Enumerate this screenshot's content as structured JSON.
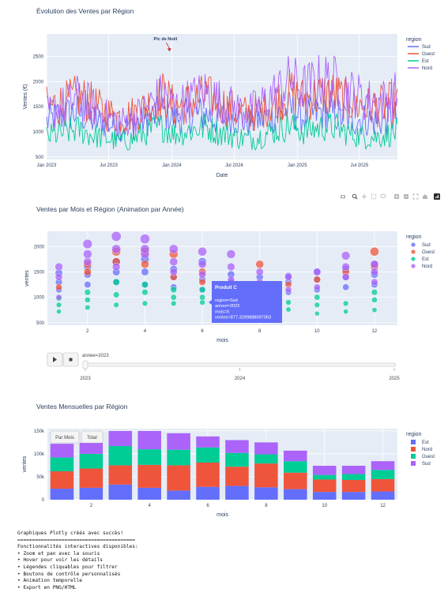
{
  "chart_data": [
    {
      "type": "line",
      "title": "Évolution des Ventes par Région",
      "xlabel": "Date",
      "ylabel": "Ventes (€)",
      "xlim": [
        "2023-01-01",
        "2025-10-20"
      ],
      "ylim": [
        450,
        2950
      ],
      "y_ticks": [
        500,
        1000,
        1500,
        2000,
        2500
      ],
      "x_ticks": [
        {
          "value": "2023-01-01",
          "label": "Jan 2023"
        },
        {
          "value": "2023-07-01",
          "label": "Jul 2023"
        },
        {
          "value": "2024-01-01",
          "label": "Jan 2024"
        },
        {
          "value": "2024-07-01",
          "label": "Jul 2024"
        },
        {
          "value": "2025-01-01",
          "label": "Jan 2025"
        },
        {
          "value": "2025-07-01",
          "label": "Jul 2025"
        }
      ],
      "legend_title": "region",
      "legend_position": "right",
      "grid": true,
      "annotation": {
        "text": "Pic de Noël",
        "x": "2023-12-25",
        "y": 2600
      },
      "series": [
        {
          "name": "Sud",
          "color": "#636efa",
          "approx_monthly_mean": [
            1200,
            1300,
            1350,
            1400,
            1250,
            1200,
            1150,
            1100,
            1150,
            1200,
            1300,
            1400,
            1250,
            1300,
            1350,
            1350,
            1250,
            1300,
            1250,
            1200,
            1250,
            1300,
            1350,
            1450,
            1300,
            1350,
            1400,
            1350,
            1300,
            1250,
            1250,
            1200,
            1250,
            1300
          ]
        },
        {
          "name": "Ouest",
          "color": "#ef553b",
          "approx_monthly_mean": [
            1500,
            1550,
            1600,
            1700,
            1600,
            1450,
            1350,
            1300,
            1350,
            1450,
            1600,
            1750,
            1500,
            1550,
            1650,
            1700,
            1600,
            1500,
            1400,
            1350,
            1400,
            1550,
            1650,
            1800,
            1650,
            1700,
            1750,
            1750,
            1650,
            1550,
            1500,
            1500,
            1550,
            1600
          ]
        },
        {
          "name": "Est",
          "color": "#00cc96",
          "approx_monthly_mean": [
            900,
            950,
            1000,
            1050,
            950,
            900,
            850,
            800,
            850,
            950,
            1050,
            1100,
            950,
            1000,
            1050,
            1100,
            1000,
            950,
            900,
            850,
            900,
            1000,
            1050,
            1150,
            1000,
            1050,
            1100,
            1100,
            1000,
            950,
            900,
            900,
            950,
            1000
          ]
        },
        {
          "name": "Nord",
          "color": "#ab63fa",
          "approx_monthly_mean": [
            1350,
            1450,
            1550,
            1700,
            1550,
            1400,
            1250,
            1200,
            1250,
            1400,
            1600,
            1750,
            1500,
            1600,
            1700,
            1800,
            1650,
            1550,
            1450,
            1400,
            1500,
            1700,
            1850,
            2050,
            1850,
            1950,
            2050,
            2000,
            1850,
            1750,
            1650,
            1600,
            1650,
            1750
          ]
        }
      ]
    },
    {
      "type": "scatter",
      "title": "Ventes par Mois et Région (Animation par Année)",
      "xlabel": "mois",
      "ylabel": "ventes",
      "xlim": [
        0.6,
        12.8
      ],
      "ylim": [
        450,
        2300
      ],
      "x_ticks": [
        2,
        4,
        6,
        8,
        10,
        12
      ],
      "y_ticks": [
        500,
        1000,
        1500,
        2000
      ],
      "legend_title": "region",
      "legend_position": "right",
      "grid": true,
      "series": [
        {
          "name": "Sud",
          "color": "#636efa",
          "points": [
            [
              1,
              1150
            ],
            [
              1,
              1300
            ],
            [
              1,
              1480
            ],
            [
              2,
              1250
            ],
            [
              2,
              1450
            ],
            [
              2,
              1600
            ],
            [
              3,
              1300
            ],
            [
              3,
              1500
            ],
            [
              3,
              1700
            ],
            [
              4,
              1250
            ],
            [
              4,
              1500
            ],
            [
              4,
              1750
            ],
            [
              5,
              1200
            ],
            [
              5,
              1400
            ],
            [
              5,
              1550
            ],
            [
              6,
              1150
            ],
            [
              6,
              1350
            ],
            [
              6,
              1700
            ],
            [
              7,
              1100
            ],
            [
              7,
              1300
            ],
            [
              7,
              1450
            ],
            [
              8,
              1050
            ],
            [
              8,
              1250
            ],
            [
              8,
              1400
            ],
            [
              9,
              1100
            ],
            [
              9,
              1300
            ],
            [
              9,
              1420
            ],
            [
              10,
              1150
            ],
            [
              10,
              1350
            ],
            [
              10,
              1500
            ],
            [
              11,
              1200
            ],
            [
              11,
              1400
            ],
            [
              11,
              1550
            ],
            [
              12,
              1250
            ],
            [
              12,
              1450
            ],
            [
              12,
              1650
            ]
          ]
        },
        {
          "name": "Ouest",
          "color": "#ef553b",
          "points": [
            [
              1,
              1200
            ],
            [
              2,
              1500
            ],
            [
              2,
              1650
            ],
            [
              3,
              1700
            ],
            [
              3,
              1900
            ],
            [
              4,
              1650
            ],
            [
              4,
              1900
            ],
            [
              5,
              1400
            ],
            [
              5,
              1850
            ],
            [
              6,
              1300
            ],
            [
              6,
              1500
            ],
            [
              7,
              1200
            ],
            [
              8,
              1650
            ],
            [
              9,
              1250
            ],
            [
              10,
              1350
            ],
            [
              11,
              1500
            ],
            [
              12,
              1600
            ],
            [
              12,
              1900
            ]
          ]
        },
        {
          "name": "Est",
          "color": "#00cc96",
          "points": [
            [
              1,
              720
            ],
            [
              1,
              850
            ],
            [
              1,
              980
            ],
            [
              2,
              800
            ],
            [
              2,
              950
            ],
            [
              2,
              1100
            ],
            [
              3,
              850
            ],
            [
              3,
              1050
            ],
            [
              3,
              1300
            ],
            [
              4,
              880
            ],
            [
              4,
              1100
            ],
            [
              4,
              1250
            ],
            [
              5,
              880
            ],
            [
              5,
              1000
            ],
            [
              5,
              1150
            ],
            [
              6,
              900
            ],
            [
              6,
              1000
            ],
            [
              6,
              1150
            ],
            [
              7,
              850
            ],
            [
              7,
              1050
            ],
            [
              8,
              800
            ],
            [
              8,
              950
            ],
            [
              9,
              760
            ],
            [
              9,
              900
            ],
            [
              10,
              680
            ],
            [
              10,
              850
            ],
            [
              10,
              1000
            ],
            [
              11,
              720
            ],
            [
              11,
              880
            ],
            [
              12,
              750
            ],
            [
              12,
              950
            ],
            [
              12,
              1100
            ]
          ]
        },
        {
          "name": "Nord",
          "color": "#ab63fa",
          "points": [
            [
              1,
              1000
            ],
            [
              1,
              1400
            ],
            [
              1,
              1600
            ],
            [
              2,
              1700
            ],
            [
              2,
              1850
            ],
            [
              2,
              2050
            ],
            [
              3,
              1600
            ],
            [
              3,
              1950
            ],
            [
              3,
              2200
            ],
            [
              4,
              1850
            ],
            [
              4,
              1950
            ],
            [
              4,
              2150
            ],
            [
              5,
              1500
            ],
            [
              5,
              1700
            ],
            [
              5,
              1950
            ],
            [
              6,
              1450
            ],
            [
              6,
              1650
            ],
            [
              6,
              1900
            ],
            [
              7,
              1350
            ],
            [
              7,
              1600
            ],
            [
              7,
              1850
            ],
            [
              8,
              1300
            ],
            [
              8,
              1500
            ],
            [
              9,
              1150
            ],
            [
              9,
              1400
            ],
            [
              10,
              1200
            ],
            [
              10,
              1500
            ],
            [
              11,
              1400
            ],
            [
              11,
              1600
            ],
            [
              11,
              1820
            ],
            [
              12,
              1300
            ],
            [
              12,
              1500
            ],
            [
              12,
              1650
            ]
          ]
        }
      ],
      "hover_label": {
        "title": "Produit C",
        "lines": [
          "region=Sud",
          "annee=2023",
          "mois=6",
          "ventes=877.3299888097063"
        ]
      },
      "slider": {
        "current_label": "annee=2023",
        "steps": [
          "2023",
          "2024",
          "2025"
        ]
      }
    },
    {
      "type": "bar",
      "stacked": true,
      "title": "Ventes Mensuelles par Région",
      "xlabel": "mois",
      "ylabel": "ventes",
      "ylim": [
        0,
        155000
      ],
      "y_ticks": [
        {
          "value": 0,
          "label": "0"
        },
        {
          "value": 50000,
          "label": "50k"
        },
        {
          "value": 100000,
          "label": "100k"
        },
        {
          "value": 150000,
          "label": "150k"
        }
      ],
      "x_ticks": [
        2,
        4,
        6,
        8,
        10,
        12
      ],
      "categories": [
        1,
        2,
        3,
        4,
        5,
        6,
        7,
        8,
        9,
        10,
        11,
        12
      ],
      "legend_title": "region",
      "legend_position": "right",
      "grid": true,
      "series": [
        {
          "name": "Est",
          "color": "#636efa",
          "values": [
            24000,
            26000,
            33000,
            26000,
            20000,
            28000,
            30000,
            27000,
            23000,
            17000,
            17000,
            18000
          ]
        },
        {
          "name": "Nord",
          "color": "#ef553b",
          "values": [
            38000,
            42000,
            42000,
            50000,
            55000,
            53000,
            42000,
            52000,
            36000,
            27000,
            26000,
            27000
          ]
        },
        {
          "name": "Ouest",
          "color": "#00cc96",
          "values": [
            30000,
            32000,
            42000,
            34000,
            34000,
            33000,
            30000,
            20000,
            25000,
            10000,
            13000,
            20000
          ]
        },
        {
          "name": "Sud",
          "color": "#ab63fa",
          "values": [
            30000,
            24000,
            33000,
            40000,
            36000,
            24000,
            28000,
            26000,
            23000,
            20000,
            18000,
            19000
          ]
        }
      ],
      "buttons": [
        "Par Mois",
        "Total"
      ]
    }
  ],
  "toolbar": {
    "icons": [
      "camera-icon",
      "zoom-icon",
      "pan-icon",
      "box-select-icon",
      "lasso-icon",
      "zoom-in-icon",
      "zoom-out-icon",
      "autoscale-icon",
      "reset-icon",
      "plotly-logo-icon"
    ]
  },
  "output_lines": [
    "Graphiques Plotly créés avec succès!",
    "========================================",
    "Fonctionnalités interactives disponibles:",
    "• Zoom et pan avec la souris",
    "• Hover pour voir les détails",
    "• Légendes cliquables pour filtrer",
    "• Boutons de contrôle personnalisés",
    "• Animation temporelle",
    "• Export en PNG/HTML"
  ]
}
